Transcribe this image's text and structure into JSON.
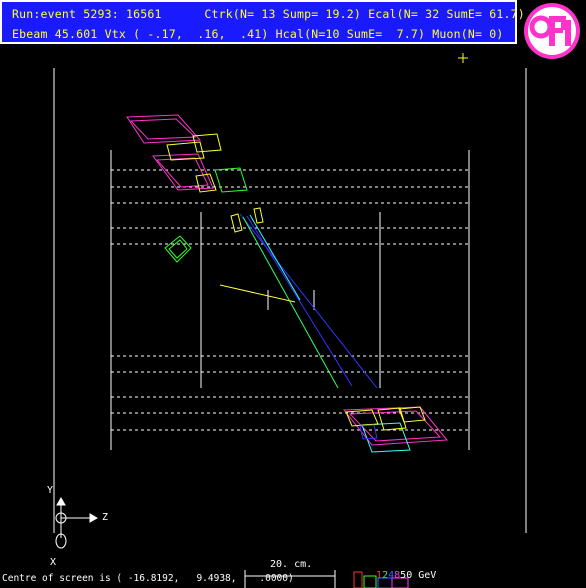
{
  "header": {
    "line1": "Run:event 5293: 16561      Ctrk(N= 13 Sump= 19.2) Ecal(N= 32 SumE= 61.7)",
    "line2": "Ebeam 45.601 Vtx ( -.17,  .16,  .41) Hcal(N=10 SumE=  7.7) Muon(N= 0)"
  },
  "logo": {
    "text": "OPAL",
    "color": "#ff33cc"
  },
  "axes": {
    "y_label": "Y",
    "z_label": "Z",
    "x_label": "X"
  },
  "scale": {
    "label": "20. cm."
  },
  "energy_legend": {
    "items": [
      {
        "text": "1",
        "color": "#ff3333"
      },
      {
        "text": "2",
        "color": "#33ff33"
      },
      {
        "text": "4",
        "color": "#3366ff"
      },
      {
        "text": "8",
        "color": "#ff33ff"
      },
      {
        "text": "50 GeV",
        "color": "#ffffff"
      }
    ]
  },
  "footer": {
    "text": "Centre of screen is ( -16.8192,   9.4938,    .0000)"
  },
  "colors": {
    "background": "#000000",
    "header_bg": "#1a1aff",
    "header_text": "#ffff33",
    "detector": "#ffffff",
    "ecal": "#ff33cc",
    "hcal": "#ffff33",
    "muon": "#33ff33",
    "track_blue": "#3333ff",
    "track_cyan": "#33ffff"
  }
}
